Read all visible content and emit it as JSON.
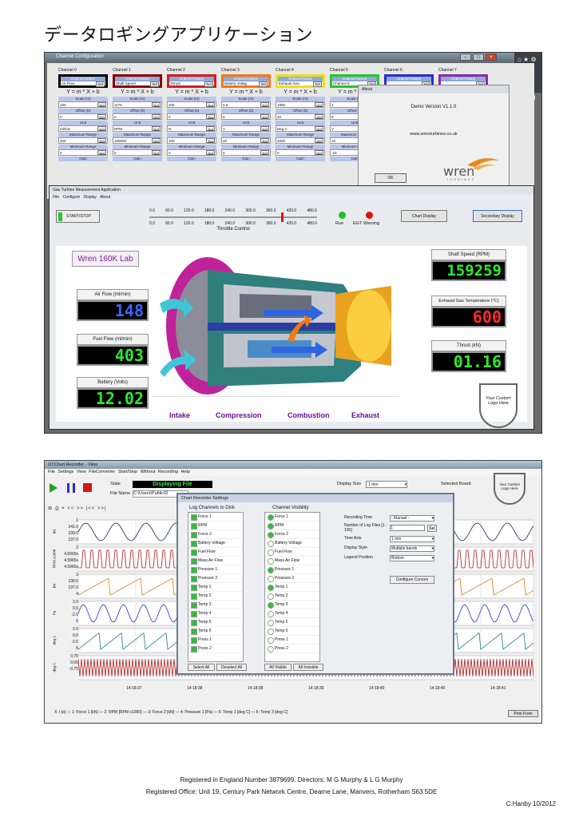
{
  "title": "データロギングアプリケーション",
  "channel_config": {
    "window_title": "Channel Configuration",
    "equation": "Y = m * X + b",
    "field_labels": {
      "name": "Channel Name",
      "scale": "Scale (m)",
      "offset": "Offset (b)",
      "unit": "Unit",
      "max": "Maximum Range",
      "min": "Minimum Range",
      "gain": "Gain"
    },
    "set_label": "Set",
    "channels": [
      {
        "label": "Channel 0",
        "name": "Air Flow",
        "scale": "100",
        "offset": "0",
        "unit": "ml/min",
        "max": "400",
        "min": "0",
        "color": "#000000"
      },
      {
        "label": "Channel 1",
        "name": "Shaft Speed",
        "scale": "1175",
        "offset": "0",
        "unit": "RPM",
        "max": "100000",
        "min": "0",
        "color": "#8b0000"
      },
      {
        "label": "Channel 2",
        "name": "Thrust",
        "scale": "200",
        "offset": "0",
        "unit": "N",
        "max": "100",
        "min": "0",
        "color": "#d21e1e"
      },
      {
        "label": "Channel 3",
        "name": "Battery Voltag",
        "scale": "0.5",
        "offset": "0",
        "unit": "V",
        "max": "20",
        "min": "0",
        "color": "#f07a14"
      },
      {
        "label": "Channel 4",
        "name": "Exhaust Gas",
        "scale": "1000",
        "offset": "20",
        "unit": "Deg C",
        "max": "2000",
        "min": "0",
        "color": "#f0e014"
      },
      {
        "label": "Channel 5",
        "name": "Channel 5",
        "scale": "1",
        "offset": "0",
        "unit": "V",
        "max": "10",
        "min": "-10",
        "color": "#27c427"
      },
      {
        "label": "Channel 6",
        "name": "",
        "scale": "",
        "offset": "",
        "unit": "",
        "max": "",
        "min": "",
        "color": "#2a2ad2"
      },
      {
        "label": "Channel 7",
        "name": "",
        "scale": "",
        "offset": "",
        "unit": "",
        "max": "",
        "min": "",
        "color": "#8a2aa0"
      }
    ]
  },
  "about": {
    "title": "About",
    "version": "Demo Version V1.1.0",
    "url": "www.wrenturbines.co.uk",
    "ok": "OK",
    "logo": "wren",
    "logo_sub": "TURBINES"
  },
  "gtm": {
    "window_title": "Gas Turbine Measurement Application",
    "menu": [
      "File",
      "Configure",
      "Display",
      "About"
    ],
    "start_stop": "START/STOP",
    "throttle_ticks": [
      "0.0",
      "60.0",
      "120.0",
      "180.0",
      "240.0",
      "300.0",
      "360.0",
      "420.0",
      "480.0"
    ],
    "throttle_label": "Throttle Control",
    "run_label": "Run",
    "egt_label": "EGT Warning",
    "chart_display": "Chart Display",
    "secondary_display": "Secondary Display",
    "lab_title": "Wren 160K Lab",
    "air_flow_label": "Air Flow (ml/min)",
    "air_flow_value": "148",
    "fuel_flow_label": "Fuel Flow (ml/min)",
    "fuel_flow_value": "403",
    "battery_label": "Battery (Volts)",
    "battery_value": "12.02",
    "shaft_label": "Shaft Speed (RPM)",
    "shaft_value": "159259",
    "egt_temp_label": "Exhaust Gas Temperature (°C)",
    "egt_temp_value": "600",
    "thrust_label": "Thrust (kN)",
    "thrust_value": "01.16",
    "stages": [
      "Intake",
      "Compression",
      "Combustion",
      "Exhaust"
    ],
    "custom_logo": "Your Custom Logo Here"
  },
  "recorder": {
    "window_title": "OTChart Recorder - View",
    "menu": [
      "File",
      "Settings",
      "View",
      "FileConverter",
      "Start/Stop Without Recording",
      "Help"
    ],
    "state_label": "State",
    "state_value": "Displaying File",
    "file_label": "File Name",
    "file_value": "C:\\Users\\Public\\D",
    "display_size_label": "Display Size",
    "display_size_value": "1 min",
    "selected_board": "Selected Board",
    "custom_logo": "Your Custom Logo Here",
    "toolbar_text": "<< >>    |<< >>|",
    "y_labels": [
      {
        "axis": "kN",
        "ticks": [
          "1",
          "141.0",
          "139.0",
          "137.0"
        ]
      },
      {
        "axis": "RPM x1000",
        "ticks": [
          "2",
          "4.6000s",
          "4.5965s",
          "4.5965s"
        ]
      },
      {
        "axis": "kN",
        "ticks": [
          "3",
          "139.5",
          "137.0",
          "4"
        ]
      },
      {
        "axis": "Pa",
        "ticks": [
          "2.0",
          "0.0",
          "-2.0",
          "5"
        ]
      },
      {
        "axis": "deg C",
        "ticks": [
          "2.0",
          "0.0",
          "-2.0",
          "6"
        ]
      },
      {
        "axis": "deg C",
        "ticks": [
          "0.75",
          "0.00",
          "-0.75"
        ]
      }
    ],
    "x_ticks": [
      "14:18:37",
      "14:18:38",
      "14:18:38",
      "14:18:39",
      "14:18:40",
      "14:18:40",
      "14:18:41"
    ],
    "legend": "X: t [s] — 1: Force 1 [kN] — 2: RPM [RPM x1000] — 3: Force 2 [kN] — 4: Pressure 1 [Pa] — 5: Temp 1 [deg C] — 6: Temp 3 [deg C]",
    "print_form": "Print Form",
    "settings": {
      "title": "Chart Recorder Settings",
      "log_header": "Log Channels to Disk",
      "vis_header": "Channel Visibility",
      "channels": [
        "Force 1",
        "RPM",
        "Force 2",
        "Battery Voltage",
        "Fuel Flow",
        "Mass Air Flow",
        "Pressure 1",
        "Pressure 2",
        "Temp 1",
        "Temp 2",
        "Temp 3",
        "Temp 4",
        "Temp 5",
        "Temp 6",
        "Press 1",
        "Press 2"
      ],
      "visible": [
        true,
        true,
        true,
        false,
        false,
        false,
        true,
        false,
        true,
        false,
        true,
        false,
        false,
        false,
        false,
        false
      ],
      "select_all": "Select All",
      "deselect_all": "Deselect All",
      "all_visible": "All Visible",
      "all_invisible": "All Invisible",
      "recording_time_label": "Recording Time",
      "recording_time_value": "- Manual -",
      "num_log_label": "Number of Log Files [1 - 100]",
      "num_log_value": "1",
      "time_axis_label": "Time Axis",
      "time_axis_value": "1 min",
      "display_style_label": "Display Style",
      "display_style_value": "Multiple bands",
      "legend_pos_label": "Legend Position",
      "legend_pos_value": "Bottom",
      "configure_cursors": "Configure Cursors",
      "set": "Set"
    }
  },
  "footer": {
    "line1": "Registered in England Number 3879699. Directors:  M G Murphy & L G Murphy",
    "line2": "Registered Office: Unit 19, Century Park Network Centre, Dearne Lane, Manvers, Rotherham S63 5DE",
    "author": "C.Hanby 10/2012"
  }
}
